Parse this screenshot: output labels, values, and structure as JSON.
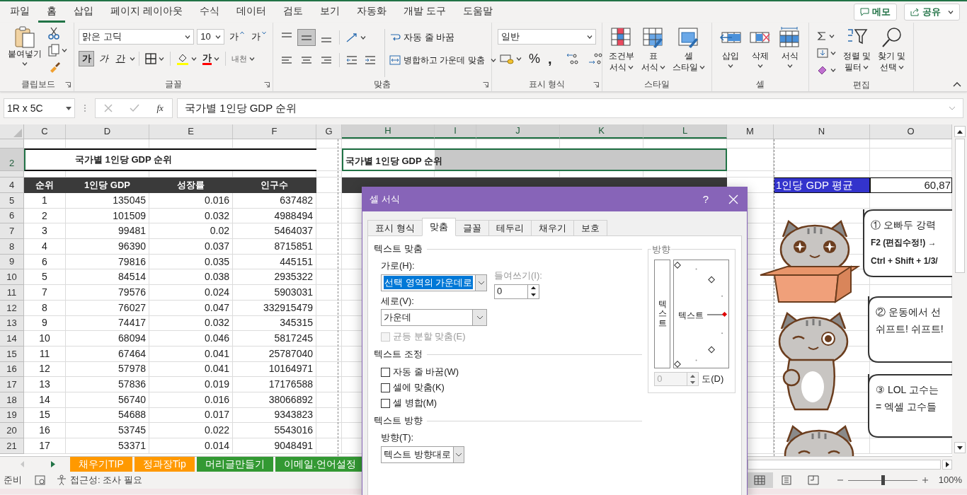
{
  "menu_tabs": [
    {
      "label": "파일",
      "selected": false
    },
    {
      "label": "홈",
      "selected": true
    },
    {
      "label": "삽입",
      "selected": false
    },
    {
      "label": "페이지 레이아웃",
      "selected": false
    },
    {
      "label": "수식",
      "selected": false
    },
    {
      "label": "데이터",
      "selected": false
    },
    {
      "label": "검토",
      "selected": false
    },
    {
      "label": "보기",
      "selected": false
    },
    {
      "label": "자동화",
      "selected": false
    },
    {
      "label": "개발 도구",
      "selected": false
    },
    {
      "label": "도움말",
      "selected": false
    }
  ],
  "header_buttons": [
    {
      "kind": "comment",
      "label": "메모"
    },
    {
      "kind": "share",
      "label": "공유"
    }
  ],
  "ribbon_groups": [
    {
      "kind": "clipboard",
      "label": "클립보드",
      "paste": "붙여넣기"
    },
    {
      "kind": "font",
      "label": "글꼴",
      "font_name": "맑은 고딕",
      "font_size": "10",
      "grow": "가",
      "shrink": "가",
      "styles": [
        {
          "kind": "bold",
          "label": "가",
          "selected": true
        },
        {
          "kind": "italic",
          "label": "가",
          "selected": false
        },
        {
          "kind": "underline",
          "label": "간",
          "selected": false
        }
      ],
      "font_color": "가",
      "phonetic": "내천"
    },
    {
      "kind": "alignment",
      "label": "맞춤",
      "vertical_align": [
        {
          "selected": false
        },
        {
          "selected": true
        },
        {
          "selected": false
        }
      ],
      "wrap": "자동 줄 바꿈",
      "merge": "병합하고 가운데 맞춤"
    },
    {
      "kind": "number",
      "label": "표시 형식",
      "format": "일반",
      "percent": "%",
      "comma": ","
    },
    {
      "kind": "styles",
      "label": "스타일",
      "buttons": [
        {
          "kind": "conditional",
          "lines": [
            "조건부",
            "서식"
          ]
        },
        {
          "kind": "table",
          "lines": [
            "표",
            "서식"
          ]
        },
        {
          "kind": "cell_style",
          "lines": [
            "셀",
            "스타일"
          ]
        }
      ]
    },
    {
      "kind": "cells",
      "label": "셀",
      "buttons": [
        {
          "kind": "insert",
          "label": "삽입"
        },
        {
          "kind": "delete",
          "label": "삭제"
        },
        {
          "kind": "format",
          "label": "서식"
        }
      ]
    },
    {
      "kind": "editing",
      "label": "편집",
      "buttons": [
        {
          "kind": "sort",
          "lines": [
            "정렬 및",
            "필터"
          ]
        },
        {
          "kind": "find",
          "lines": [
            "찾기 및",
            "선택"
          ]
        }
      ]
    }
  ],
  "formula_bar": {
    "name_box": "1R x 5C",
    "fx": "fx",
    "formula": "국가별 1인당 GDP 순위"
  },
  "sheet": {
    "columns": [
      {
        "label": "C",
        "selected": false
      },
      {
        "label": "D",
        "selected": false
      },
      {
        "label": "E",
        "selected": false
      },
      {
        "label": "F",
        "selected": false
      },
      {
        "label": "G",
        "selected": false
      },
      {
        "label": "H",
        "selected": true
      },
      {
        "label": "I",
        "selected": true
      },
      {
        "label": "J",
        "selected": true
      },
      {
        "label": "K",
        "selected": true
      },
      {
        "label": "L",
        "selected": true
      },
      {
        "label": "M",
        "selected": false
      },
      {
        "label": "N",
        "selected": false
      },
      {
        "label": "O",
        "selected": false
      }
    ],
    "rows": [
      {
        "kind": "spacer",
        "selected": false
      },
      {
        "kind": "title",
        "label": "2",
        "selected": true,
        "left_title": "국가별 1인당 GDP 순위",
        "right_title": "국가별 1인당 GDP 순위"
      },
      {
        "kind": "spacer",
        "selected": false
      },
      {
        "kind": "header",
        "label": "4",
        "selected": false,
        "headers": [
          "순위",
          "1인당 GDP",
          "성장률",
          "인구수"
        ],
        "summary_label": "1인당 GDP 평균",
        "summary_value": "60,87"
      },
      {
        "kind": "data",
        "label": "5",
        "selected": false,
        "cells": [
          "1",
          "135045",
          "0.016",
          "637482"
        ]
      },
      {
        "kind": "data",
        "label": "6",
        "selected": false,
        "cells": [
          "2",
          "101509",
          "0.032",
          "4988494"
        ]
      },
      {
        "kind": "data",
        "label": "7",
        "selected": false,
        "cells": [
          "3",
          "99481",
          "0.02",
          "5464037"
        ]
      },
      {
        "kind": "data",
        "label": "8",
        "selected": false,
        "cells": [
          "4",
          "96390",
          "0.037",
          "8715851"
        ]
      },
      {
        "kind": "data",
        "label": "9",
        "selected": false,
        "cells": [
          "6",
          "79816",
          "0.035",
          "445151"
        ]
      },
      {
        "kind": "data",
        "label": "10",
        "selected": false,
        "cells": [
          "5",
          "84514",
          "0.038",
          "2935322"
        ]
      },
      {
        "kind": "data",
        "label": "11",
        "selected": false,
        "cells": [
          "7",
          "79576",
          "0.024",
          "5903031"
        ]
      },
      {
        "kind": "data",
        "label": "12",
        "selected": false,
        "cells": [
          "8",
          "76027",
          "0.047",
          "332915479"
        ]
      },
      {
        "kind": "data",
        "label": "13",
        "selected": false,
        "cells": [
          "9",
          "74417",
          "0.032",
          "345315"
        ]
      },
      {
        "kind": "data",
        "label": "14",
        "selected": false,
        "cells": [
          "10",
          "68094",
          "0.046",
          "5817245"
        ]
      },
      {
        "kind": "data",
        "label": "15",
        "selected": false,
        "cells": [
          "11",
          "67464",
          "0.041",
          "25787040"
        ]
      },
      {
        "kind": "data",
        "label": "16",
        "selected": false,
        "cells": [
          "12",
          "57978",
          "0.041",
          "10164971"
        ]
      },
      {
        "kind": "data",
        "label": "17",
        "selected": false,
        "cells": [
          "13",
          "57836",
          "0.019",
          "17176588"
        ]
      },
      {
        "kind": "data",
        "label": "18",
        "selected": false,
        "cells": [
          "14",
          "56740",
          "0.016",
          "38066892"
        ]
      },
      {
        "kind": "data",
        "label": "19",
        "selected": false,
        "cells": [
          "15",
          "54688",
          "0.017",
          "9343823"
        ]
      },
      {
        "kind": "data",
        "label": "20",
        "selected": false,
        "cells": [
          "16",
          "53745",
          "0.022",
          "5543016"
        ]
      },
      {
        "kind": "data",
        "label": "21",
        "selected": false,
        "cells": [
          "17",
          "53371",
          "0.014",
          "9048491"
        ]
      }
    ]
  },
  "speech_bubbles": [
    {
      "lines": [
        {
          "text": "① 오빠두 강력",
          "bold": false
        },
        {
          "text": "F2 (편집수정!) →",
          "bold": true
        },
        {
          "text": "Ctrl + Shift + 1/3/",
          "bold": true
        }
      ]
    },
    {
      "lines": [
        {
          "text": "② 운동에서 선",
          "bold": false
        },
        {
          "text": "쉬프트! 쉬프트!",
          "bold": false
        }
      ]
    },
    {
      "lines": [
        {
          "text": "③ LOL 고수는",
          "bold": false
        },
        {
          "text": "= 엑셀 고수들",
          "bold": false
        }
      ]
    }
  ],
  "sheet_tabs": [
    {
      "label": "채우기TIP",
      "color": "#ff9900"
    },
    {
      "label": "정과장Tip",
      "color": "#ff9900"
    },
    {
      "label": "머리글만들기",
      "color": "#339933"
    },
    {
      "label": "이메일.언어설정",
      "color": "#339933"
    }
  ],
  "status_bar": {
    "ready": "준비",
    "accessibility": "접근성: 조사 필요",
    "views": [
      {
        "selected": true
      },
      {
        "selected": false
      },
      {
        "selected": false
      }
    ],
    "zoom": {
      "level": 0.5,
      "reading": "100%"
    }
  },
  "dialog": {
    "title": "셀 서식",
    "help": "?",
    "tabs": [
      {
        "label": "표시 형식",
        "selected": false
      },
      {
        "label": "맞춤",
        "selected": true
      },
      {
        "label": "글꼴",
        "selected": false
      },
      {
        "label": "테두리",
        "selected": false
      },
      {
        "label": "채우기",
        "selected": false
      },
      {
        "label": "보호",
        "selected": false
      }
    ],
    "alignment_section": "텍스트 맞춤",
    "horizontal": {
      "label": "가로(H):",
      "value": "선택 영역의 가운데로"
    },
    "indent": {
      "label": "들여쓰기(I):",
      "value": "0",
      "disabled": true
    },
    "vertical": {
      "label": "세로(V):",
      "value": "가운데"
    },
    "distributed": {
      "label": "균등 분할 맞춤(E)",
      "checked": false,
      "disabled": true
    },
    "control_section": "텍스트 조정",
    "checkboxes": [
      {
        "label": "자동 줄 바꿈(W)",
        "checked": false
      },
      {
        "label": "셀에 맞춤(K)",
        "checked": false
      },
      {
        "label": "셀 병합(M)",
        "checked": false
      }
    ],
    "direction_section": "텍스트 방향",
    "direction": {
      "label": "방향(T):",
      "value": "텍스트 방향대로"
    },
    "orientation": {
      "label": "방향",
      "vertical_text": "텍스트",
      "dial_text": "텍스트",
      "degrees": "0",
      "degrees_label": "도(D)"
    }
  }
}
